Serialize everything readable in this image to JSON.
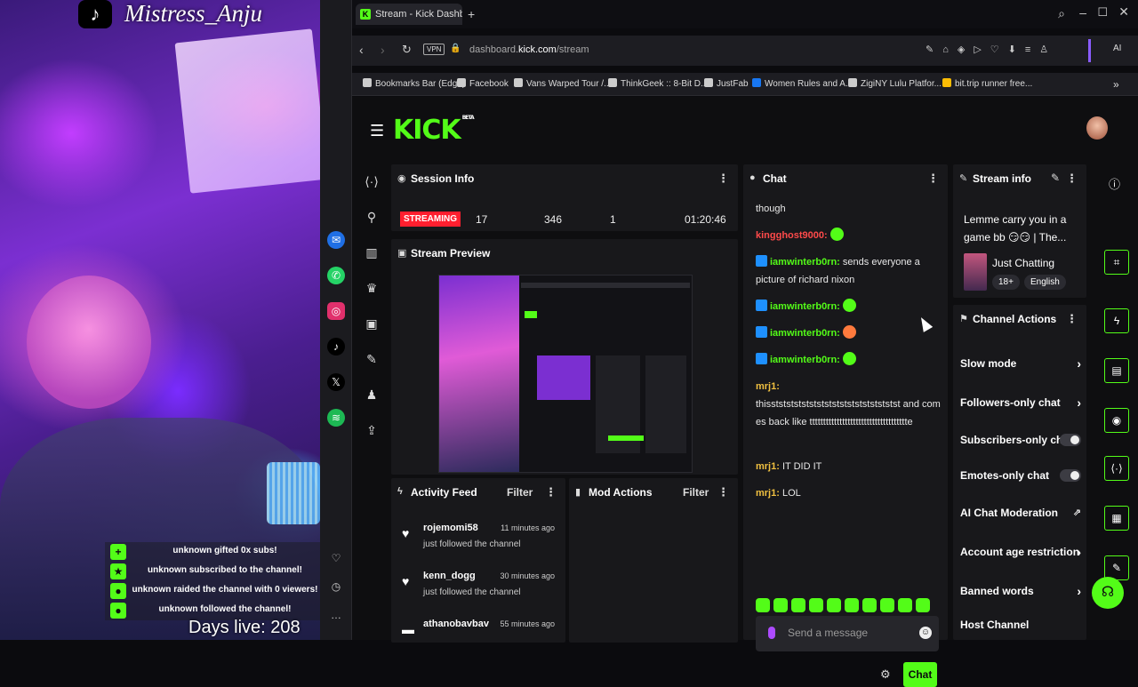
{
  "webcam": {
    "overlay_name": "Mistress_Anju",
    "days_live": "Days live: 208",
    "alerts": [
      "unknown gifted 0x subs!",
      "unknown subscribed to the channel!",
      "unknown raided the channel with 0 viewers!",
      "unknown followed the channel!"
    ]
  },
  "browser": {
    "tab_title": "Stream - Kick Dashbo",
    "url_prefix": "dashboard.",
    "url_domain": "kick.com",
    "url_path": "/stream",
    "vpn_label": "VPN",
    "bookmarks": [
      "Bookmarks Bar (Edge)",
      "Facebook",
      "Vans Warped Tour /...",
      "ThinkGeek :: 8-Bit D...",
      "JustFab",
      "Women Rules and A...",
      "ZigiNY Lulu Platfor...",
      "bit.trip runner free..."
    ]
  },
  "kick": {
    "logo": "KICK",
    "logo_sup": "BETA",
    "session": {
      "title": "Session Info",
      "status": "STREAMING",
      "stat1": "17",
      "stat2": "346",
      "stat3": "1",
      "duration": "01:20:46"
    },
    "preview": {
      "title": "Stream Preview"
    },
    "activity": {
      "title": "Activity Feed",
      "filter": "Filter",
      "items": [
        {
          "user": "rojemomi58",
          "time": "11 minutes ago",
          "desc": "just followed the channel"
        },
        {
          "user": "kenn_dogg",
          "time": "30 minutes ago",
          "desc": "just followed the channel"
        },
        {
          "user": "athanobavbav",
          "time": "55 minutes ago",
          "desc": ""
        }
      ]
    },
    "mod": {
      "title": "Mod Actions",
      "filter": "Filter"
    },
    "chat": {
      "title": "Chat",
      "messages": [
        {
          "user": "",
          "text": "though"
        },
        {
          "user": "kingghost9000:",
          "text": ""
        },
        {
          "user": "iamwinterb0rn:",
          "text": "sends everyone a picture of richard nixon"
        },
        {
          "user": "iamwinterb0rn:",
          "text": ""
        },
        {
          "user": "iamwinterb0rn:",
          "text": ""
        },
        {
          "user": "iamwinterb0rn:",
          "text": ""
        },
        {
          "user": "mrj1:",
          "text": "thisststststststststststststststststst and comes back like tttttttttttttttttttttttttttttttttttte"
        },
        {
          "user": "mrj1:",
          "text": "IT DID IT"
        },
        {
          "user": "mrj1:",
          "text": "LOL"
        }
      ],
      "placeholder": "Send a message",
      "send_label": "Chat"
    },
    "stream_info": {
      "title": "Stream info",
      "stream_title": "Lemme carry you in a game bb 😏😏 | The...",
      "category": "Just Chatting",
      "tags": [
        "18+",
        "English"
      ]
    },
    "channel_actions": {
      "title": "Channel Actions",
      "rows": [
        {
          "label": "Slow mode",
          "kind": "chevron"
        },
        {
          "label": "Followers-only chat",
          "kind": "chevron"
        },
        {
          "label": "Subscribers-only chat",
          "kind": "toggle"
        },
        {
          "label": "Emotes-only chat",
          "kind": "toggle"
        },
        {
          "label": "AI Chat Moderation",
          "kind": "link"
        },
        {
          "label": "Account age restriction",
          "kind": "chevron"
        },
        {
          "label": "Banned words",
          "kind": "chevron"
        },
        {
          "label": "Host Channel",
          "kind": "none"
        }
      ]
    }
  },
  "colors": {
    "kick_green": "#53fc18",
    "streaming_red": "#ff1f2f"
  }
}
